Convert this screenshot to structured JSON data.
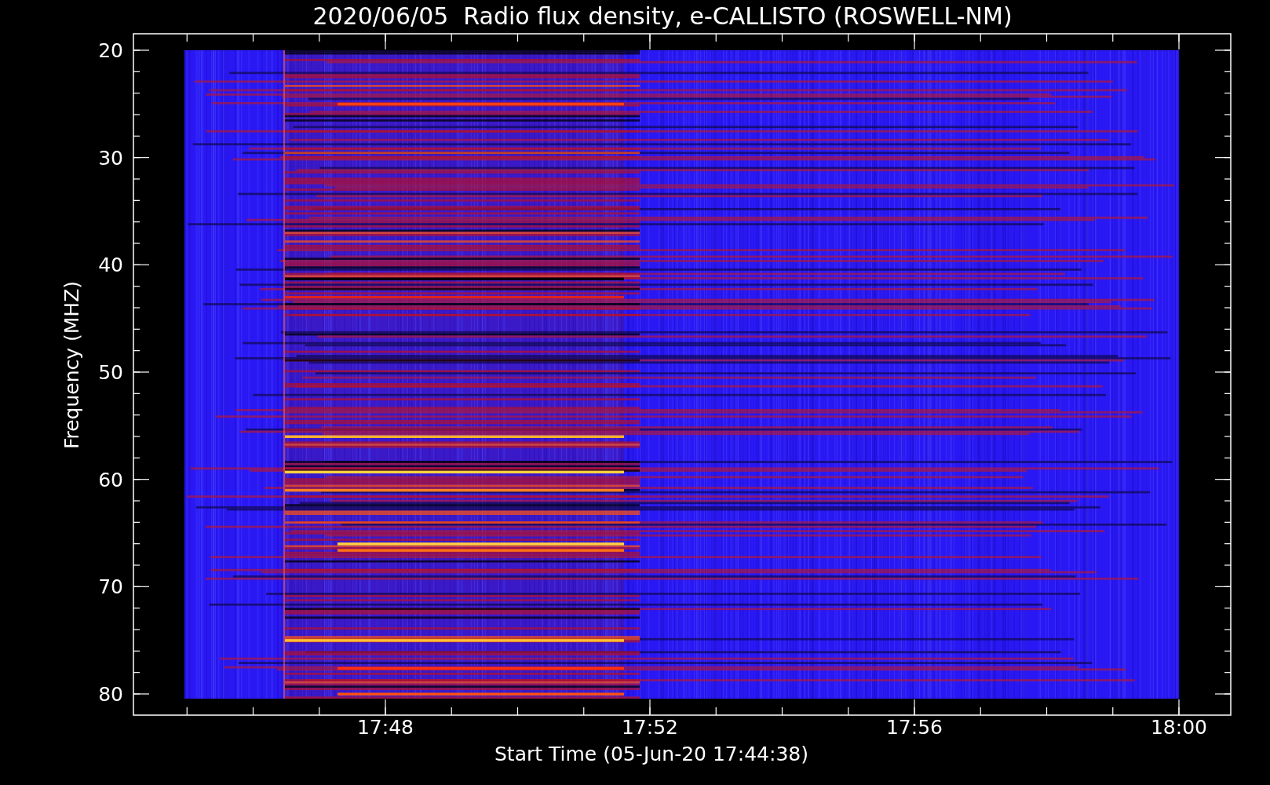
{
  "title": "2020/06/05  Radio flux density, e-CALLISTO (ROSWELL-NM)",
  "y_axis": {
    "label": "Frequency (MHZ)",
    "ticks": [
      "20",
      "30",
      "40",
      "50",
      "60",
      "70",
      "80"
    ]
  },
  "x_axis": {
    "label": "Start Time (05-Jun-20 17:44:38)",
    "ticks": [
      "17:48",
      "17:52",
      "17:56",
      "18:00"
    ]
  }
}
